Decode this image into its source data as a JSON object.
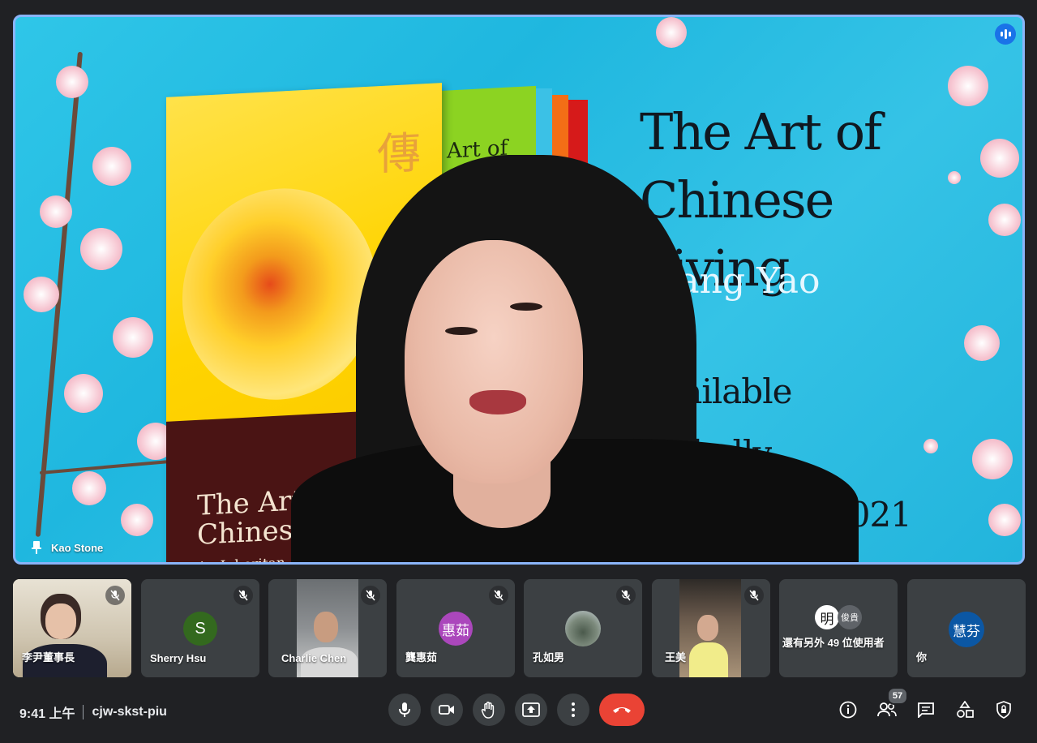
{
  "main_tile": {
    "speaker_name": "Kao Stone",
    "slide": {
      "title_line1": "The Art of",
      "title_line2": "Chinese Living",
      "author": "Xiang Yao",
      "avail_line1": "Available globally",
      "avail_line2": "mber 2021",
      "book_cover_title_line1": "The Art of",
      "book_cover_title_line2": "Chinese Li",
      "book_cover_subtitle": "An Inheritan",
      "book_cn_char": "傳",
      "book2_text": "Art of"
    }
  },
  "participants": [
    {
      "name": "李尹董事長",
      "avatar_text": "",
      "avatar_color": ""
    },
    {
      "name": "Sherry Hsu",
      "avatar_text": "S",
      "avatar_color": "#33691e"
    },
    {
      "name": "Charlie Chen",
      "avatar_text": "",
      "avatar_color": ""
    },
    {
      "name": "龔惠茹",
      "avatar_text": "惠茹",
      "avatar_color": "#ab47bc"
    },
    {
      "name": "孔如男",
      "avatar_text": "",
      "avatar_color": ""
    },
    {
      "name": "王美",
      "avatar_text": "",
      "avatar_color": ""
    },
    {
      "name": "還有另外 49 位使用者",
      "avatar_text": "明",
      "avatar_color": "#ffffff",
      "avatar2_text": "俊貴",
      "avatar2_color": "#5f6368"
    },
    {
      "name": "你",
      "avatar_text": "慧芬",
      "avatar_color": "#0b57a4"
    }
  ],
  "meeting": {
    "time": "9:41 上午",
    "code": "cjw-skst-piu"
  },
  "people_count": "57",
  "colors": {
    "background": "#202124",
    "tile": "#3c4043",
    "active_border": "#8ab4f8",
    "end_call": "#ea4335"
  }
}
